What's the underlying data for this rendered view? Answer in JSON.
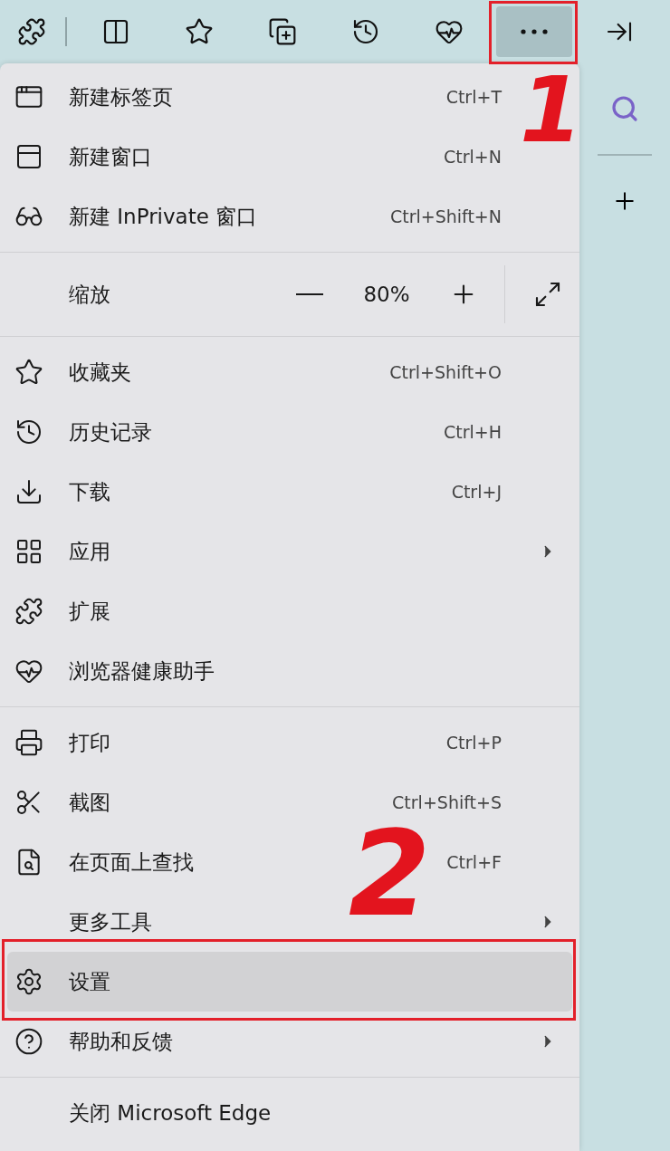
{
  "toolbar": {
    "buttons": [
      {
        "selected": false
      },
      {
        "selected": false
      },
      {
        "selected": false
      },
      {
        "selected": false
      },
      {
        "selected": false
      },
      {
        "selected": false
      },
      {
        "selected": true,
        "framed": true
      },
      {
        "selected": false
      }
    ]
  },
  "menu": {
    "entries": [
      {
        "kind": "item",
        "label": "新建标签页",
        "shortcut": "Ctrl+T",
        "submenu": false,
        "selected": false
      },
      {
        "kind": "item",
        "label": "新建窗口",
        "shortcut": "Ctrl+N",
        "submenu": false,
        "selected": false
      },
      {
        "kind": "item",
        "label": "新建 InPrivate 窗口",
        "shortcut": "Ctrl+Shift+N",
        "submenu": false,
        "selected": false
      },
      {
        "kind": "divider"
      },
      {
        "kind": "zoom",
        "label": "缩放",
        "value": "80%"
      },
      {
        "kind": "divider"
      },
      {
        "kind": "item",
        "label": "收藏夹",
        "shortcut": "Ctrl+Shift+O",
        "submenu": false,
        "selected": false
      },
      {
        "kind": "item",
        "label": "历史记录",
        "shortcut": "Ctrl+H",
        "submenu": false,
        "selected": false
      },
      {
        "kind": "item",
        "label": "下载",
        "shortcut": "Ctrl+J",
        "submenu": false,
        "selected": false
      },
      {
        "kind": "item",
        "label": "应用",
        "submenu": true,
        "selected": false
      },
      {
        "kind": "item",
        "label": "扩展",
        "submenu": false,
        "selected": false
      },
      {
        "kind": "item",
        "label": "浏览器健康助手",
        "submenu": false,
        "selected": false
      },
      {
        "kind": "divider"
      },
      {
        "kind": "item",
        "label": "打印",
        "shortcut": "Ctrl+P",
        "submenu": false,
        "selected": false
      },
      {
        "kind": "item",
        "label": "截图",
        "shortcut": "Ctrl+Shift+S",
        "submenu": false,
        "selected": false
      },
      {
        "kind": "item",
        "label": "在页面上查找",
        "shortcut": "Ctrl+F",
        "submenu": false,
        "selected": false
      },
      {
        "kind": "item",
        "label": "更多工具",
        "submenu": true,
        "selected": false
      },
      {
        "kind": "item",
        "label": "设置",
        "submenu": false,
        "selected": true,
        "framed": true
      },
      {
        "kind": "item",
        "label": "帮助和反馈",
        "submenu": true,
        "selected": false
      },
      {
        "kind": "divider"
      },
      {
        "kind": "item",
        "label": "关闭 Microsoft Edge",
        "submenu": false,
        "selected": false
      }
    ]
  },
  "annotations": [
    {
      "label": "1"
    },
    {
      "label": "2"
    }
  ]
}
